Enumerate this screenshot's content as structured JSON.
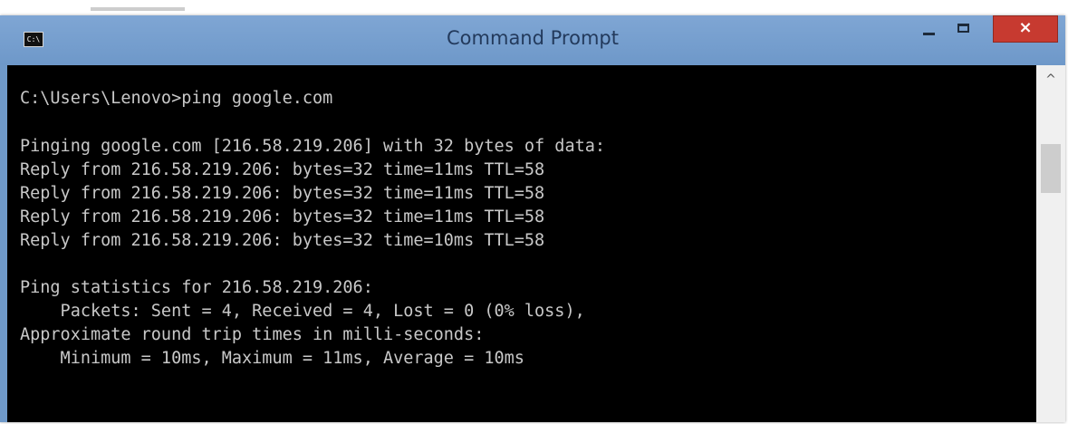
{
  "window": {
    "title": "Command Prompt",
    "icon_label": "C:\\",
    "controls": {
      "minimize_icon": "minimize-icon",
      "maximize_icon": "maximize-icon",
      "close_icon": "close-icon",
      "close_glyph": "×"
    },
    "accent_color": "#6f99c9",
    "close_color": "#c73a30"
  },
  "console": {
    "background": "#000000",
    "foreground": "#c8c8c8",
    "lines": [
      "C:\\Users\\Lenovo>ping google.com",
      "",
      "Pinging google.com [216.58.219.206] with 32 bytes of data:",
      "Reply from 216.58.219.206: bytes=32 time=11ms TTL=58",
      "Reply from 216.58.219.206: bytes=32 time=11ms TTL=58",
      "Reply from 216.58.219.206: bytes=32 time=11ms TTL=58",
      "Reply from 216.58.219.206: bytes=32 time=10ms TTL=58",
      "",
      "Ping statistics for 216.58.219.206:",
      "    Packets: Sent = 4, Received = 4, Lost = 0 (0% loss),",
      "Approximate round trip times in milli-seconds:",
      "    Minimum = 10ms, Maximum = 11ms, Average = 10ms"
    ]
  },
  "scrollbar": {
    "up_arrow": "^"
  }
}
